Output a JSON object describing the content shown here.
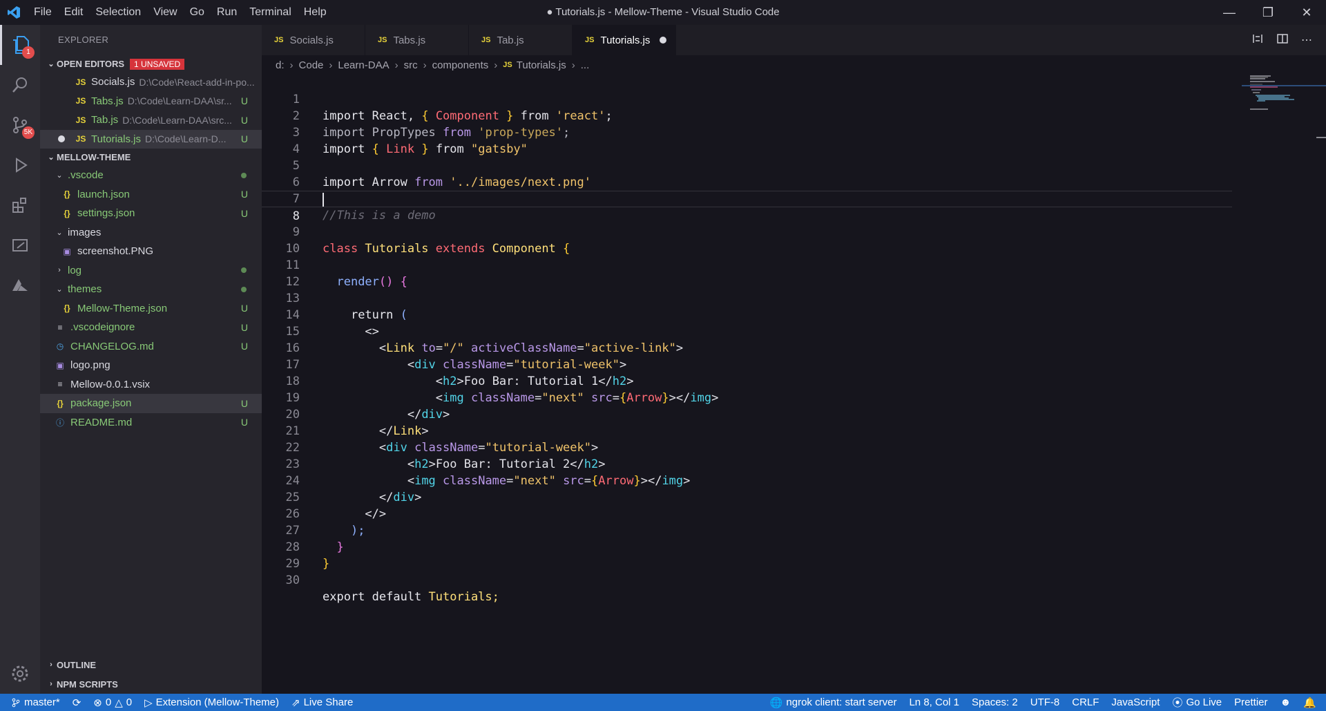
{
  "window": {
    "title": "● Tutorials.js - Mellow-Theme - Visual Studio Code",
    "menu": [
      "File",
      "Edit",
      "Selection",
      "View",
      "Go",
      "Run",
      "Terminal",
      "Help"
    ]
  },
  "activity_bar": {
    "explorer_badge": "1",
    "scm_badge": "5K"
  },
  "sidebar": {
    "title": "EXPLORER",
    "open_editors": {
      "label": "OPEN EDITORS",
      "unsaved": "1 UNSAVED",
      "items": [
        {
          "name": "Socials.js",
          "path": "D:\\Code\\React-add-in-po...",
          "status": ""
        },
        {
          "name": "Tabs.js",
          "path": "D:\\Code\\Learn-DAA\\sr...",
          "status": "U"
        },
        {
          "name": "Tab.js",
          "path": "D:\\Code\\Learn-DAA\\src...",
          "status": "U"
        },
        {
          "name": "Tutorials.js",
          "path": "D:\\Code\\Learn-D...",
          "status": "U"
        }
      ]
    },
    "project": {
      "label": "MELLOW-THEME",
      "items": [
        {
          "name": ".vscode",
          "status": ""
        },
        {
          "name": "launch.json",
          "status": "U"
        },
        {
          "name": "settings.json",
          "status": "U"
        },
        {
          "name": "images",
          "status": ""
        },
        {
          "name": "screenshot.PNG",
          "status": ""
        },
        {
          "name": "log",
          "status": ""
        },
        {
          "name": "themes",
          "status": ""
        },
        {
          "name": "Mellow-Theme.json",
          "status": "U"
        },
        {
          "name": ".vscodeignore",
          "status": "U"
        },
        {
          "name": "CHANGELOG.md",
          "status": "U"
        },
        {
          "name": "logo.png",
          "status": ""
        },
        {
          "name": "Mellow-0.0.1.vsix",
          "status": ""
        },
        {
          "name": "package.json",
          "status": "U"
        },
        {
          "name": "README.md",
          "status": "U"
        }
      ]
    },
    "outline": "OUTLINE",
    "npm_scripts": "NPM SCRIPTS"
  },
  "tabs": [
    "Socials.js",
    "Tabs.js",
    "Tab.js",
    "Tutorials.js"
  ],
  "breadcrumb": [
    "d:",
    "Code",
    "Learn-DAA",
    "src",
    "components",
    "Tutorials.js",
    "..."
  ],
  "editor": {
    "line_numbers": [
      "1",
      "2",
      "3",
      "4",
      "5",
      "6",
      "7",
      "8",
      "9",
      "10",
      "11",
      "12",
      "13",
      "14",
      "15",
      "16",
      "17",
      "18",
      "19",
      "20",
      "21",
      "22",
      "23",
      "24",
      "25",
      "26",
      "27",
      "28",
      "29",
      "30"
    ],
    "tokens": {
      "import": "import",
      "react": "React, ",
      "lb": "{ ",
      "component": "Component",
      "rb": " }",
      "from": " from ",
      "react_str": "'react'",
      "semi": ";",
      "proptypes": " PropTypes ",
      "from2": "from ",
      "proptypes_str": "'prop-types'",
      "link": "Link",
      "gatsby_str": "\"gatsby\"",
      "arrow": " Arrow ",
      "from3": "from ",
      "next_str": "'../images/next.png'",
      "comment": "//This is a demo",
      "class": "class ",
      "tutorials": "Tutorials",
      "extends": " extends ",
      "component2": "Component",
      "lbrace": " {",
      "render": "render",
      "parens": "() ",
      "rbrace_open": "{",
      "return": "return ",
      "lparen": "(",
      "frag_open": "<>",
      "lt": "<",
      "gt": ">",
      "to_attr": " to",
      "eq": "=",
      "slash_str": "\"/\"",
      "active_attr": " activeClassName",
      "active_str": "\"active-link\"",
      "div": "div",
      "classname_attr": " className",
      "week_str": "\"tutorial-week\"",
      "h2": "h2",
      "foo1": "Foo Bar: Tutorial 1",
      "foo2": "Foo Bar: Tutorial 2",
      "close_h2": "</",
      "img": "img",
      "next_attr_str": "\"next\"",
      "src_attr": " src",
      "arrow_expr_open": "{",
      "arrow_id": "Arrow",
      "arrow_expr_close": "}",
      "close_img": "></",
      "close_div": "</",
      "close_link": "</",
      "frag_close": "</>",
      "rparen": ");",
      "rbrace": "}",
      "export": "export default ",
      "tutorials_end": "Tutorials;"
    }
  },
  "statusbar": {
    "branch": "master*",
    "errors": "0",
    "warnings": "0",
    "extension": "Extension (Mellow-Theme)",
    "liveshare": "Live Share",
    "ngrok": "ngrok client: start server",
    "position": "Ln 8, Col 1",
    "spaces": "Spaces: 2",
    "encoding": "UTF-8",
    "eol": "CRLF",
    "language": "JavaScript",
    "golive": "Go Live",
    "prettier": "Prettier"
  }
}
